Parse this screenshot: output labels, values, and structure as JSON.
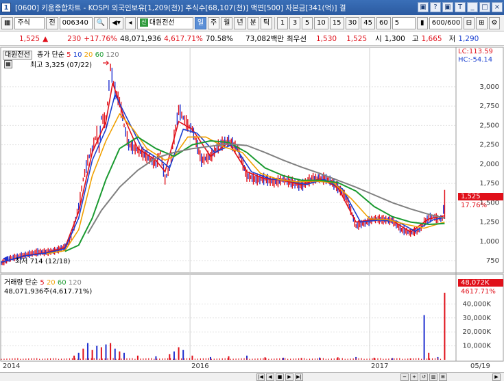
{
  "window": {
    "app_num": "1",
    "title": "[0600] 키움종합차트 - KOSPI 외국인보유[1,209(천)] 주식수[68,107(천)] 액면[500] 자본금[341(억)] 결",
    "buttons": [
      "▣",
      "?",
      "▣",
      "T",
      "_",
      "□",
      "×"
    ]
  },
  "toolbar": {
    "market": "주식",
    "prev_label": "전",
    "code": "006340",
    "name": "대원전선",
    "periods": [
      "일",
      "주",
      "월",
      "년",
      "분",
      "틱"
    ],
    "active_period": "일",
    "intervals": [
      "1",
      "3",
      "5",
      "10",
      "15",
      "30",
      "45",
      "60"
    ],
    "count": "5",
    "page": "600/600"
  },
  "quote": {
    "price": "1,525",
    "arrow": "▲",
    "change": "230",
    "change_pct": "+17.76%",
    "volume": "48,071,936",
    "volume_pct": "4,617.71%",
    "turnover": "70.58%",
    "amount": "73,082백만",
    "pref_label": "최우선",
    "bid": "1,530",
    "ask": "1,525",
    "open_label": "시",
    "open": "1,300",
    "high_label": "고",
    "high": "1,665",
    "low_label": "저",
    "low": "1,290"
  },
  "price_panel": {
    "stock_label": "대원전선",
    "ma_label": "종가 단순",
    "ma_periods": [
      "5",
      "10",
      "20",
      "60",
      "120"
    ],
    "high_note": "최고 3,325 (07/22)",
    "low_note": "최저 714 (12/18)",
    "lc": "LC:113.59",
    "hc": "HC:-54.14",
    "cur_price": "1,525",
    "cur_pct": "17.76%"
  },
  "volume_panel": {
    "label": "거래량 단순",
    "ma_periods": [
      "5",
      "20",
      "60",
      "120"
    ],
    "value_note": "48,071,936주(4,617.71%)",
    "cur_vol": "48,072K",
    "cur_pct": "4617.71%"
  },
  "colors": {
    "ma5": "#e0101a",
    "ma10": "#1a3fd0",
    "ma20": "#f0a000",
    "ma60": "#1a9a30",
    "ma120": "#808080",
    "candle_up": "#e0101a",
    "candle_down": "#2030d0"
  },
  "chart_data": {
    "type": "line",
    "price": {
      "ylim": [
        600,
        3450
      ],
      "yticks": [
        750,
        1000,
        1250,
        1500,
        1750,
        2000,
        2250,
        2500,
        2750,
        3000
      ],
      "ytick_labels": [
        "750",
        "1,000",
        "1,250",
        "1,500",
        "1,750",
        "2,000",
        "2,250",
        "2,500",
        "2,750",
        "3,000"
      ],
      "close": [
        [
          0.0,
          720
        ],
        [
          0.02,
          780
        ],
        [
          0.05,
          820
        ],
        [
          0.08,
          860
        ],
        [
          0.1,
          860
        ],
        [
          0.12,
          880
        ],
        [
          0.14,
          930
        ],
        [
          0.15,
          1000
        ],
        [
          0.16,
          1200
        ],
        [
          0.17,
          1450
        ],
        [
          0.18,
          1800
        ],
        [
          0.19,
          2050
        ],
        [
          0.2,
          2200
        ],
        [
          0.21,
          2400
        ],
        [
          0.215,
          2200
        ],
        [
          0.22,
          2600
        ],
        [
          0.23,
          2550
        ],
        [
          0.24,
          3250
        ],
        [
          0.25,
          2950
        ],
        [
          0.26,
          2800
        ],
        [
          0.27,
          2500
        ],
        [
          0.28,
          2250
        ],
        [
          0.3,
          2180
        ],
        [
          0.32,
          2100
        ],
        [
          0.34,
          2000
        ],
        [
          0.35,
          2150
        ],
        [
          0.36,
          1800
        ],
        [
          0.37,
          1950
        ],
        [
          0.38,
          2350
        ],
        [
          0.39,
          2700
        ],
        [
          0.4,
          2600
        ],
        [
          0.41,
          2500
        ],
        [
          0.42,
          2450
        ],
        [
          0.44,
          2050
        ],
        [
          0.46,
          2100
        ],
        [
          0.48,
          2250
        ],
        [
          0.5,
          2300
        ],
        [
          0.52,
          2200
        ],
        [
          0.54,
          1850
        ],
        [
          0.56,
          1800
        ],
        [
          0.58,
          1810
        ],
        [
          0.6,
          1760
        ],
        [
          0.62,
          1800
        ],
        [
          0.64,
          1760
        ],
        [
          0.66,
          1720
        ],
        [
          0.68,
          1800
        ],
        [
          0.7,
          1820
        ],
        [
          0.72,
          1800
        ],
        [
          0.74,
          1700
        ],
        [
          0.76,
          1550
        ],
        [
          0.78,
          1200
        ],
        [
          0.8,
          1240
        ],
        [
          0.82,
          1290
        ],
        [
          0.84,
          1280
        ],
        [
          0.86,
          1270
        ],
        [
          0.88,
          1150
        ],
        [
          0.9,
          1110
        ],
        [
          0.92,
          1150
        ],
        [
          0.93,
          1250
        ],
        [
          0.94,
          1300
        ],
        [
          0.95,
          1320
        ],
        [
          0.96,
          1290
        ],
        [
          0.97,
          1300
        ],
        [
          0.975,
          1525
        ]
      ],
      "ma_lines": [
        {
          "name": "5",
          "points": [
            [
              0,
              725
            ],
            [
              0.05,
              815
            ],
            [
              0.1,
              855
            ],
            [
              0.14,
              920
            ],
            [
              0.17,
              1380
            ],
            [
              0.2,
              2150
            ],
            [
              0.23,
              2550
            ],
            [
              0.245,
              3050
            ],
            [
              0.27,
              2600
            ],
            [
              0.3,
              2200
            ],
            [
              0.34,
              2050
            ],
            [
              0.36,
              1900
            ],
            [
              0.39,
              2550
            ],
            [
              0.42,
              2450
            ],
            [
              0.46,
              2100
            ],
            [
              0.5,
              2280
            ],
            [
              0.54,
              1900
            ],
            [
              0.58,
              1810
            ],
            [
              0.62,
              1790
            ],
            [
              0.66,
              1730
            ],
            [
              0.7,
              1810
            ],
            [
              0.74,
              1700
            ],
            [
              0.78,
              1250
            ],
            [
              0.82,
              1280
            ],
            [
              0.86,
              1270
            ],
            [
              0.9,
              1120
            ],
            [
              0.94,
              1290
            ],
            [
              0.975,
              1330
            ]
          ]
        },
        {
          "name": "10",
          "points": [
            [
              0,
              730
            ],
            [
              0.05,
              810
            ],
            [
              0.1,
              850
            ],
            [
              0.14,
              905
            ],
            [
              0.17,
              1300
            ],
            [
              0.2,
              2050
            ],
            [
              0.23,
              2450
            ],
            [
              0.25,
              2900
            ],
            [
              0.28,
              2550
            ],
            [
              0.31,
              2200
            ],
            [
              0.35,
              2050
            ],
            [
              0.37,
              1950
            ],
            [
              0.4,
              2450
            ],
            [
              0.43,
              2400
            ],
            [
              0.47,
              2150
            ],
            [
              0.51,
              2260
            ],
            [
              0.55,
              1900
            ],
            [
              0.59,
              1810
            ],
            [
              0.63,
              1785
            ],
            [
              0.67,
              1735
            ],
            [
              0.71,
              1800
            ],
            [
              0.75,
              1680
            ],
            [
              0.79,
              1250
            ],
            [
              0.83,
              1275
            ],
            [
              0.87,
              1260
            ],
            [
              0.91,
              1130
            ],
            [
              0.95,
              1280
            ],
            [
              0.975,
              1310
            ]
          ]
        },
        {
          "name": "20",
          "points": [
            [
              0.1,
              840
            ],
            [
              0.14,
              880
            ],
            [
              0.17,
              1150
            ],
            [
              0.2,
              1850
            ],
            [
              0.23,
              2300
            ],
            [
              0.26,
              2650
            ],
            [
              0.29,
              2450
            ],
            [
              0.32,
              2200
            ],
            [
              0.36,
              2050
            ],
            [
              0.38,
              2100
            ],
            [
              0.41,
              2350
            ],
            [
              0.45,
              2350
            ],
            [
              0.49,
              2220
            ],
            [
              0.53,
              2150
            ],
            [
              0.57,
              1880
            ],
            [
              0.61,
              1800
            ],
            [
              0.65,
              1770
            ],
            [
              0.69,
              1780
            ],
            [
              0.73,
              1760
            ],
            [
              0.77,
              1550
            ],
            [
              0.81,
              1290
            ],
            [
              0.85,
              1280
            ],
            [
              0.89,
              1220
            ],
            [
              0.93,
              1170
            ],
            [
              0.975,
              1250
            ]
          ]
        },
        {
          "name": "60",
          "points": [
            [
              0.14,
              870
            ],
            [
              0.17,
              950
            ],
            [
              0.2,
              1300
            ],
            [
              0.23,
              1800
            ],
            [
              0.26,
              2200
            ],
            [
              0.3,
              2350
            ],
            [
              0.34,
              2200
            ],
            [
              0.38,
              2100
            ],
            [
              0.42,
              2250
            ],
            [
              0.46,
              2300
            ],
            [
              0.5,
              2280
            ],
            [
              0.54,
              2150
            ],
            [
              0.58,
              1950
            ],
            [
              0.62,
              1850
            ],
            [
              0.66,
              1790
            ],
            [
              0.7,
              1790
            ],
            [
              0.74,
              1760
            ],
            [
              0.78,
              1650
            ],
            [
              0.82,
              1450
            ],
            [
              0.86,
              1320
            ],
            [
              0.9,
              1250
            ],
            [
              0.94,
              1220
            ],
            [
              0.975,
              1230
            ]
          ]
        },
        {
          "name": "120",
          "points": [
            [
              0.19,
              1100
            ],
            [
              0.22,
              1400
            ],
            [
              0.26,
              1700
            ],
            [
              0.3,
              1920
            ],
            [
              0.34,
              2080
            ],
            [
              0.38,
              2150
            ],
            [
              0.42,
              2200
            ],
            [
              0.46,
              2230
            ],
            [
              0.5,
              2260
            ],
            [
              0.54,
              2240
            ],
            [
              0.58,
              2150
            ],
            [
              0.62,
              2050
            ],
            [
              0.66,
              1960
            ],
            [
              0.7,
              1880
            ],
            [
              0.74,
              1790
            ],
            [
              0.78,
              1700
            ],
            [
              0.82,
              1600
            ],
            [
              0.86,
              1500
            ],
            [
              0.9,
              1420
            ],
            [
              0.94,
              1350
            ],
            [
              0.975,
              1300
            ]
          ]
        }
      ]
    },
    "volume": {
      "ylim": [
        0,
        50000
      ],
      "yticks": [
        10000,
        20000,
        30000,
        40000
      ],
      "ytick_labels": [
        "10,000K",
        "20,000K",
        "30,000K",
        "40,000K"
      ],
      "bars": [
        [
          0.16,
          3000
        ],
        [
          0.17,
          5000
        ],
        [
          0.18,
          8000
        ],
        [
          0.19,
          12000
        ],
        [
          0.2,
          7000
        ],
        [
          0.21,
          10000
        ],
        [
          0.22,
          9000
        ],
        [
          0.23,
          11000
        ],
        [
          0.24,
          12000
        ],
        [
          0.25,
          8000
        ],
        [
          0.26,
          6000
        ],
        [
          0.27,
          5000
        ],
        [
          0.3,
          3000
        ],
        [
          0.34,
          2500
        ],
        [
          0.37,
          4000
        ],
        [
          0.38,
          6000
        ],
        [
          0.39,
          9000
        ],
        [
          0.4,
          7000
        ],
        [
          0.42,
          3000
        ],
        [
          0.46,
          2000
        ],
        [
          0.5,
          2500
        ],
        [
          0.54,
          3000
        ],
        [
          0.58,
          1800
        ],
        [
          0.62,
          1500
        ],
        [
          0.66,
          1300
        ],
        [
          0.7,
          1600
        ],
        [
          0.74,
          1800
        ],
        [
          0.78,
          2000
        ],
        [
          0.82,
          1500
        ],
        [
          0.86,
          1200
        ],
        [
          0.9,
          1000
        ],
        [
          0.93,
          32000
        ],
        [
          0.94,
          5000
        ],
        [
          0.96,
          2000
        ],
        [
          0.975,
          48072
        ]
      ]
    },
    "x_labels": [
      {
        "x": 0.0,
        "label": "2014"
      },
      {
        "x": 0.415,
        "label": "2016"
      },
      {
        "x": 0.81,
        "label": "2017"
      },
      {
        "x": 0.99,
        "label": "05/19"
      }
    ]
  }
}
